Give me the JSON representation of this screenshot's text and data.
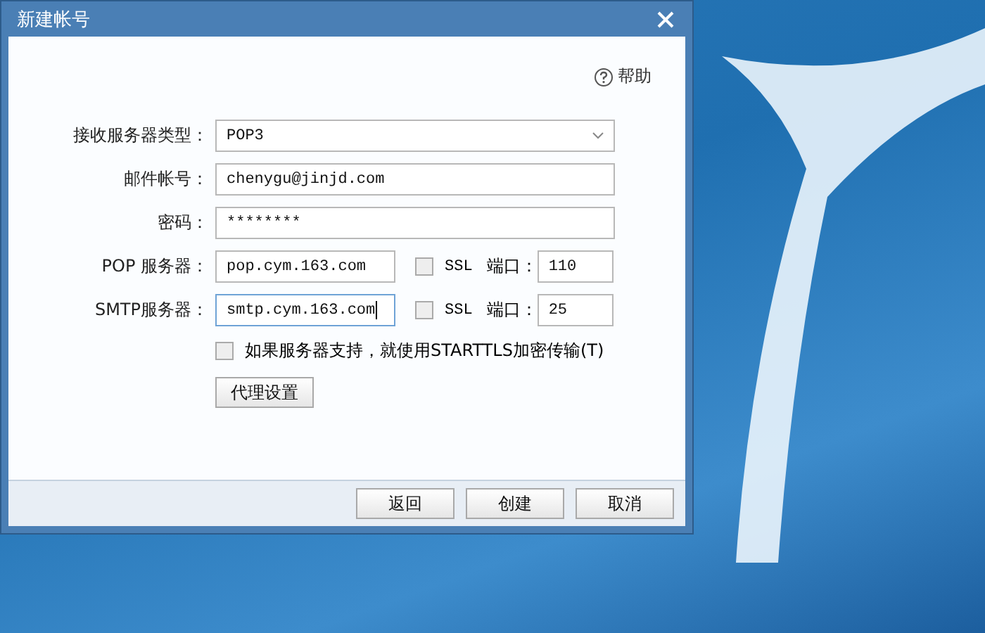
{
  "window": {
    "title": "新建帐号"
  },
  "help": {
    "label": "帮助"
  },
  "fields": [
    {
      "kind": "select",
      "label": "接收服务器类型：",
      "value": "POP3"
    },
    {
      "kind": "text",
      "label": "邮件帐号：",
      "value": "chenygu@jinjd.com"
    },
    {
      "kind": "text",
      "label": "密码：",
      "value": "********"
    }
  ],
  "servers": [
    {
      "label": "POP 服务器：",
      "value": "pop.cym.163.com",
      "focused": false,
      "ssl_label": "SSL",
      "ssl_checked": false,
      "port_label": "端口：",
      "port": "110"
    },
    {
      "label": "SMTP服务器：",
      "value": "smtp.cym.163.com",
      "focused": true,
      "ssl_label": "SSL",
      "ssl_checked": false,
      "port_label": "端口：",
      "port": "25"
    }
  ],
  "starttls": {
    "label": "如果服务器支持，就使用STARTTLS加密传输(T)",
    "checked": false
  },
  "proxy_button": "代理设置",
  "buttons": [
    "返回",
    "创建",
    "取消"
  ]
}
